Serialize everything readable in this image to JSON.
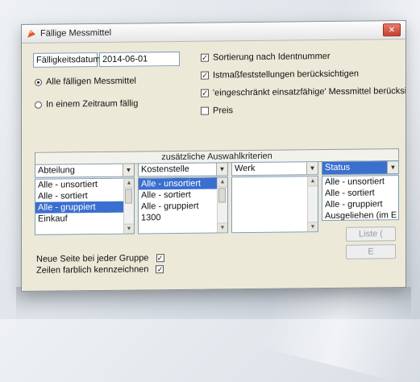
{
  "window": {
    "title": "Fällige Messmittel"
  },
  "form": {
    "date_label": "Fälligkeitsdatum",
    "date_value": "2014-06-01",
    "radio_all": "Alle fälligen Messmittel",
    "radio_period": "In einem Zeitraum fällig",
    "check_sort": "Sortierung nach Identnummer",
    "check_ist": "Istmaßfeststellungen berücksichtigen",
    "check_restricted": "'eingeschränkt einsatzfähige' Messmittel berücksichtigen",
    "check_price": "Preis",
    "check_mark": "✓"
  },
  "criteria": {
    "header": "zusätzliche Auswahlkriterien",
    "columns": [
      {
        "name": "Abteilung",
        "items": [
          "Alle - unsortiert",
          "Alle - sortiert",
          "Alle - gruppiert",
          "Einkauf"
        ]
      },
      {
        "name": "Kostenstelle",
        "items": [
          "Alle - unsortiert",
          "Alle - sortiert",
          "Alle - gruppiert",
          "1300"
        ]
      },
      {
        "name": "Werk",
        "items": []
      },
      {
        "name": "Status",
        "items": [
          "Alle - unsortiert",
          "Alle - sortiert",
          "Alle - gruppiert",
          "Ausgeliehen (im E"
        ]
      }
    ]
  },
  "footer": {
    "new_page": "Neue Seite bei jeder Gruppe",
    "color_rows": "Zeilen farblich kennzeichnen",
    "btn_list": "Liste (",
    "btn_exit": "E"
  },
  "colors": {
    "selection": "#3b6fcf",
    "close": "#c5402e"
  }
}
